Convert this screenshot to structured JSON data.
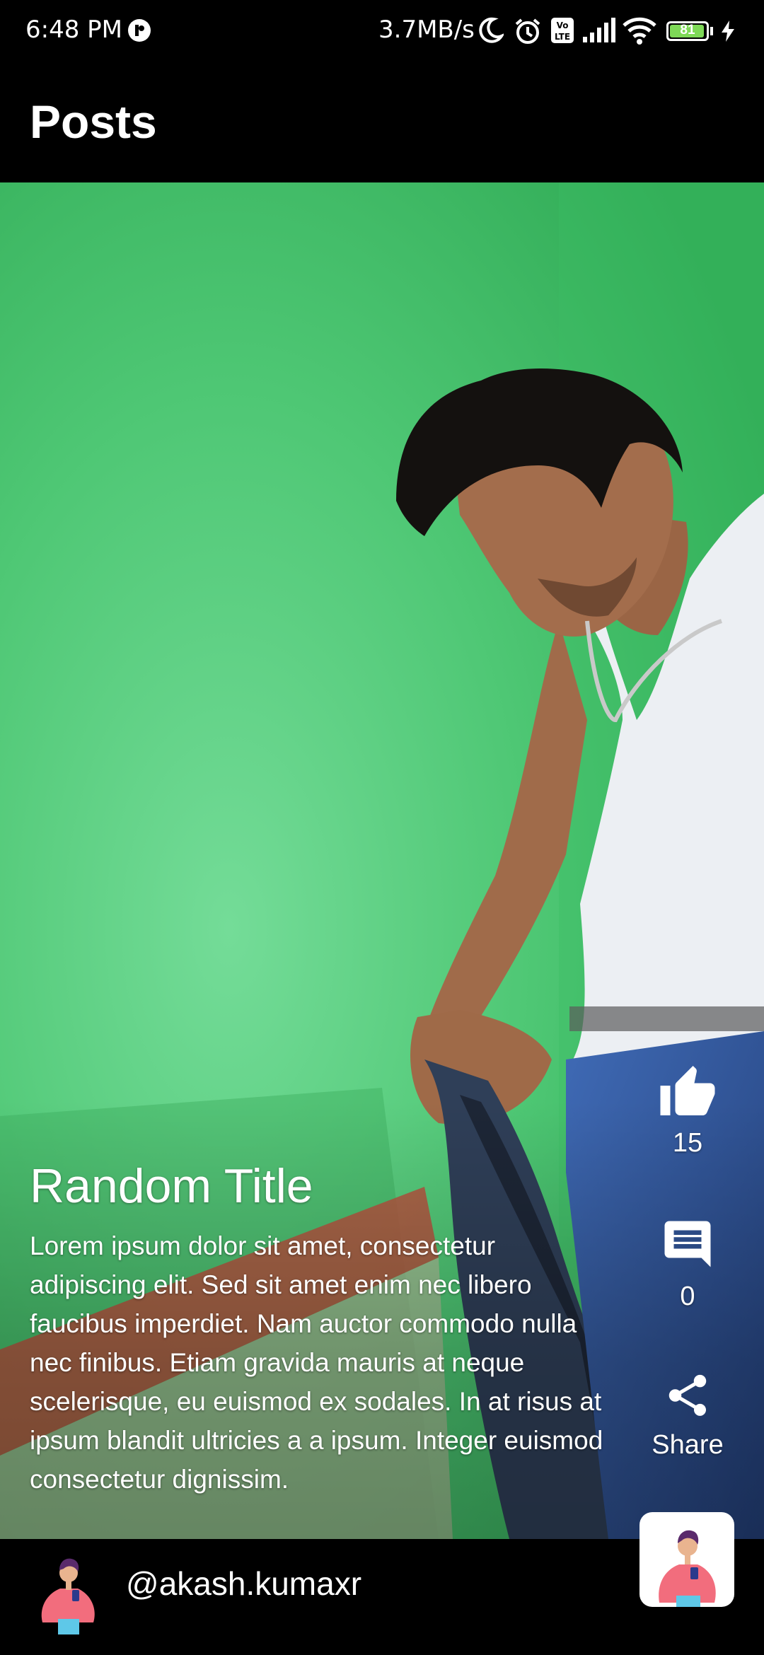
{
  "status_bar": {
    "time": "6:48 PM",
    "network_speed": "3.7MB/s",
    "battery_level": "81",
    "icons": [
      "notification-dot-icon",
      "moon-icon",
      "alarm-icon",
      "volte-icon",
      "signal-icon",
      "wifi-icon",
      "battery-icon",
      "charging-icon"
    ]
  },
  "app_bar": {
    "title": "Posts"
  },
  "post": {
    "title": "Random Title",
    "description": "Lorem ipsum dolor sit amet, consectetur adipiscing elit. Sed sit amet enim nec libero faucibus imperdiet. Nam auctor commodo nulla nec finibus. Etiam gravida mauris at neque scelerisque, eu euismod ex sodales. In at risus at ipsum blandit ultricies a a ipsum. Integer euismod consectetur dignissim.",
    "likes": "15",
    "comments": "0",
    "share_label": "Share"
  },
  "author": {
    "username": "@akash.kumaxr"
  },
  "colors": {
    "background": "#000000",
    "green_screen": "#4cc873",
    "battery": "#7ed957"
  }
}
